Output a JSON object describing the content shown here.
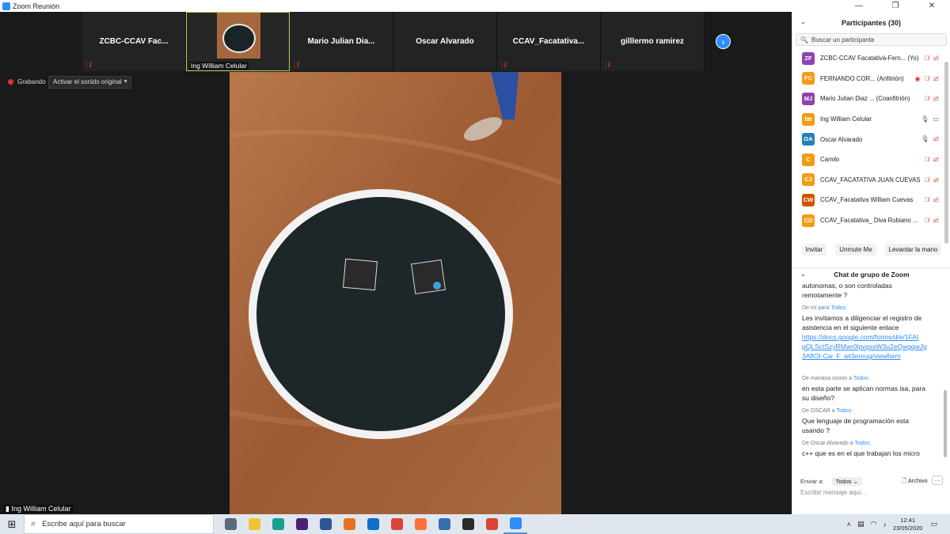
{
  "window": {
    "title": "Zoom Reunión",
    "min": "—",
    "max": "❐",
    "close": "✕"
  },
  "strip": {
    "tiles": [
      {
        "name": "ZCBC-CCAV  Fac..."
      },
      {
        "name": "",
        "bottom_label": "Ing William Celular",
        "active": true
      },
      {
        "name": "Mario  Julian  Dia..."
      },
      {
        "name": "Oscar Alvarado"
      },
      {
        "name": "CCAV_Facatativa..."
      },
      {
        "name": "gilllermo ramirez"
      }
    ],
    "next_icon": "›"
  },
  "recording": {
    "label": "Grabando",
    "button": "Activar el sonido original"
  },
  "main_video": {
    "label": "Ing William Celular"
  },
  "participants": {
    "title": "Participantes (30)",
    "search_placeholder": "Buscar un participante",
    "items": [
      {
        "initials": "ZF",
        "color": "#8e44ad",
        "name": "ZCBC-CCAV Facatativá-Fern... (Yo)",
        "icons": [
          "mic-off",
          "video-off"
        ]
      },
      {
        "initials": "FC",
        "color": "#f39c12",
        "name": "FERNANDO COR... (Anfitrión)",
        "icons": [
          "record",
          "mic-off",
          "video-off"
        ]
      },
      {
        "initials": "MJ",
        "color": "#8e44ad",
        "name": "Mario Julian Diaz ... (Coanfitrión)",
        "icons": [
          "mic-off",
          "video-off"
        ]
      },
      {
        "initials": "IW",
        "color": "#f39c12",
        "name": "Ing William Celular",
        "icons": [
          "mic",
          "video"
        ]
      },
      {
        "initials": "OA",
        "color": "#2980b9",
        "name": "Oscar Alvarado",
        "icons": [
          "mic",
          "video-off"
        ]
      },
      {
        "initials": "C",
        "color": "#f39c12",
        "name": "Camilo",
        "icons": [
          "mic-off",
          "video-off"
        ]
      },
      {
        "initials": "CJ",
        "color": "#f39c12",
        "name": "CCAV_FACATATIVA JUAN CUEVAS",
        "icons": [
          "mic-off",
          "video-off"
        ]
      },
      {
        "initials": "CW",
        "color": "#d35400",
        "name": "CCAV_Facatativa William Cuevas",
        "icons": [
          "mic-off",
          "video-off"
        ]
      },
      {
        "initials": "CD",
        "color": "#f39c12",
        "name": "CCAV_Facatativa_ Diva Rubiano ...",
        "icons": [
          "mic-off",
          "video-off"
        ]
      }
    ],
    "buttons": [
      "Invitar",
      "Unmute Me",
      "Levantar la mano"
    ]
  },
  "chat": {
    "title": "Chat de grupo de Zoom",
    "messages": [
      {
        "from": "",
        "to": "",
        "lines": [
          "autonomas, o son controladas",
          "remotamente ?"
        ]
      },
      {
        "from": "De mí",
        "to": "para Todos:",
        "lines": [
          "Les invitamos a diligenciar el registro de",
          "asistencia en el siguiente enlace"
        ],
        "link": [
          "https://docs.google.com/forms/d/e/1FAI",
          "pQLSctSzyRMwr0lpvgssW3u2eQwgqwJg",
          "3AflOI-Cw_F_wt3enrug/viewform"
        ]
      },
      {
        "from": "De mariana osorio a",
        "to": "Todos:",
        "lines": [
          "en esta parte se aplican normas isa, para",
          "su diseño?"
        ]
      },
      {
        "from": "De OSCAR a",
        "to": "Todos:",
        "lines": [
          "Que lenguaje de programación esta",
          "usando ?"
        ]
      },
      {
        "from": "De Oscar Alvarado a",
        "to": "Todos:",
        "lines": [
          "c++ que es en el que trabajan los micro"
        ]
      }
    ],
    "send_to_label": "Enviar a:",
    "send_to_value": "Todos",
    "file_label": "Archivo",
    "input_placeholder": "Escribir mensaje aquí..."
  },
  "taskbar": {
    "search_placeholder": "Escribe aquí para buscar",
    "time": "12:41",
    "date": "23/05/2020",
    "apps": [
      {
        "name": "task-view-icon",
        "color": "#5c6b7a"
      },
      {
        "name": "file-explorer-icon",
        "color": "#f4c430"
      },
      {
        "name": "edge-icon",
        "color": "#1a9f8f"
      },
      {
        "name": "app-purple-icon",
        "color": "#4b1f7a"
      },
      {
        "name": "app-cube-icon",
        "color": "#2f5597"
      },
      {
        "name": "sublime-icon",
        "color": "#e8721c"
      },
      {
        "name": "teamviewer-icon",
        "color": "#0e6fc7"
      },
      {
        "name": "chrome-icon",
        "color": "#db4437"
      },
      {
        "name": "firefox-icon",
        "color": "#ff7139"
      },
      {
        "name": "shield-app-icon",
        "color": "#3a6db0"
      },
      {
        "name": "terminal-app-icon",
        "color": "#2b2b2b"
      },
      {
        "name": "chrome-2-icon",
        "color": "#db4437"
      },
      {
        "name": "zoom-icon",
        "color": "#2d8cff"
      }
    ]
  }
}
